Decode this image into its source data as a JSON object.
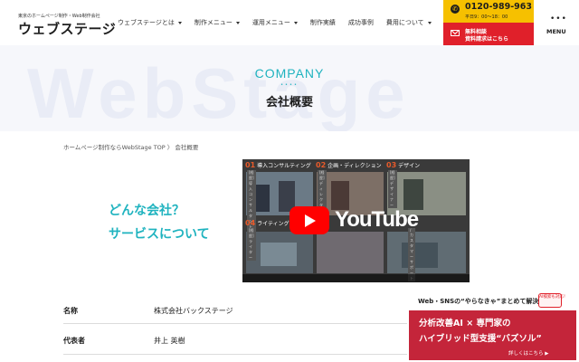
{
  "header": {
    "logo_tagline": "東京のホームページ制作・Web制作会社",
    "logo_name": "ウェブステージ",
    "nav": [
      {
        "label": "ウェブステージとは",
        "has_caret": true
      },
      {
        "label": "制作メニュー",
        "has_caret": true
      },
      {
        "label": "運用メニュー",
        "has_caret": true
      },
      {
        "label": "制作実績",
        "has_caret": false
      },
      {
        "label": "成功事例",
        "has_caret": false
      },
      {
        "label": "費用について",
        "has_caret": true
      }
    ],
    "phone_number": "0120-989-963",
    "phone_hours": "平日9：00～18：00",
    "request_line1": "無料相談",
    "request_line2": "資料請求はこちら",
    "menu_label": "MENU",
    "colors": {
      "phone_bg": "#f6c000",
      "request_bg": "#e0202a"
    }
  },
  "hero": {
    "watermark": "WebStage",
    "title_en": "COMPANY",
    "dots": "••••",
    "title_ja": "会社概要",
    "accent": "#1fb3bf"
  },
  "breadcrumb": {
    "home": "ホームページ制作ならWebStage TOP",
    "separator": "〉",
    "current": "会社概要"
  },
  "intro": {
    "line1": "どんな会社？",
    "line2": "サービスについて"
  },
  "video": {
    "logo_text": "YouTube",
    "tiles": [
      {
        "num": "01",
        "title": "導入コンサルティング",
        "tag": "[経歴] 導入コンサルタント"
      },
      {
        "num": "02",
        "title": "企画・ディレクション",
        "tag": "[経歴] ディレクター"
      },
      {
        "num": "03",
        "title": "デザイン",
        "tag": "[経歴] デザイナー"
      },
      {
        "num": "04",
        "title": "ライティング",
        "tag": "[経歴] ライター"
      },
      {
        "num": "",
        "title": "",
        "tag": ""
      },
      {
        "num": "",
        "title": "",
        "tag": "/ カスタマーサポート"
      }
    ]
  },
  "company_info": [
    {
      "label": "名称",
      "value": "株式会社バックステージ"
    },
    {
      "label": "代表者",
      "value": "井上 英樹"
    }
  ],
  "ad": {
    "top_line": "Web・SNSの“やらなきゃ”まとめて解決！",
    "badge": "AI検索も対応！",
    "line1": "分析改善AI × 専門家の",
    "line2": "ハイブリッド型支援“バズソル”",
    "more": "詳しくはこちら ▶"
  }
}
